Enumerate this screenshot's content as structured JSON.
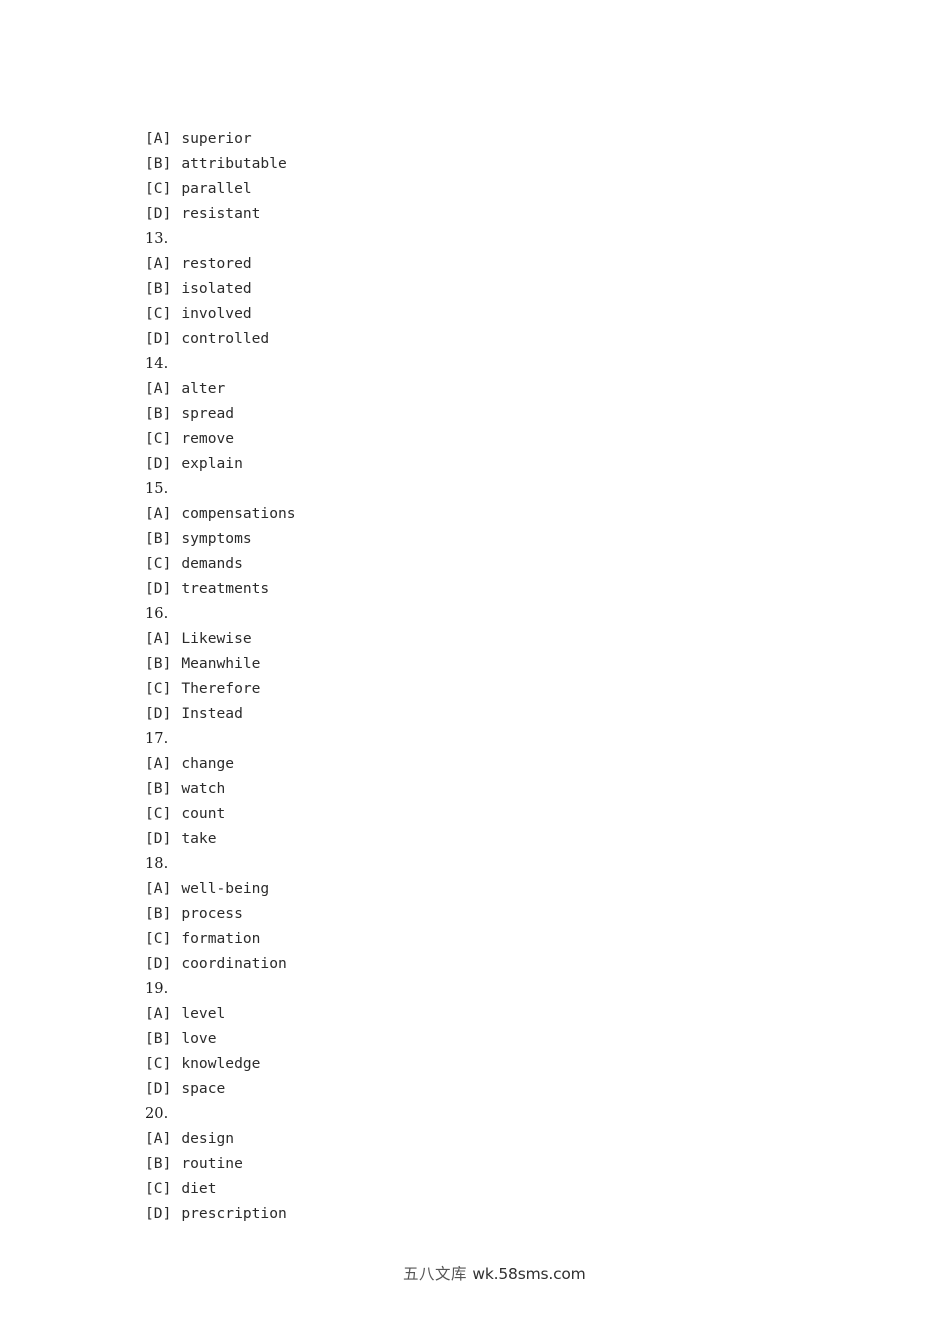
{
  "document": {
    "background_color": "#ffffff",
    "text_color": "#2b2b2b",
    "lines": [
      {
        "kind": "option",
        "tag": "[A]",
        "text": "superior"
      },
      {
        "kind": "option",
        "tag": "[B]",
        "text": "attributable"
      },
      {
        "kind": "option",
        "tag": "[C]",
        "text": "parallel"
      },
      {
        "kind": "option",
        "tag": "[D]",
        "text": "resistant"
      },
      {
        "kind": "question",
        "tag": "",
        "text": "13."
      },
      {
        "kind": "option",
        "tag": "[A]",
        "text": "restored"
      },
      {
        "kind": "option",
        "tag": "[B]",
        "text": "isolated"
      },
      {
        "kind": "option",
        "tag": "[C]",
        "text": "involved"
      },
      {
        "kind": "option",
        "tag": "[D]",
        "text": "controlled"
      },
      {
        "kind": "question",
        "tag": "",
        "text": "14."
      },
      {
        "kind": "option",
        "tag": "[A]",
        "text": "alter"
      },
      {
        "kind": "option",
        "tag": "[B]",
        "text": "spread"
      },
      {
        "kind": "option",
        "tag": "[C]",
        "text": "remove"
      },
      {
        "kind": "option",
        "tag": "[D]",
        "text": "explain"
      },
      {
        "kind": "question",
        "tag": "",
        "text": "15."
      },
      {
        "kind": "option",
        "tag": "[A]",
        "text": "compensations"
      },
      {
        "kind": "option",
        "tag": "[B]",
        "text": "symptoms"
      },
      {
        "kind": "option",
        "tag": "[C]",
        "text": "demands"
      },
      {
        "kind": "option",
        "tag": "[D]",
        "text": "treatments"
      },
      {
        "kind": "question",
        "tag": "",
        "text": "16."
      },
      {
        "kind": "option",
        "tag": "[A]",
        "text": "Likewise"
      },
      {
        "kind": "option",
        "tag": "[B]",
        "text": "Meanwhile"
      },
      {
        "kind": "option",
        "tag": "[C]",
        "text": "Therefore"
      },
      {
        "kind": "option",
        "tag": "[D]",
        "text": "Instead"
      },
      {
        "kind": "question",
        "tag": "",
        "text": "17."
      },
      {
        "kind": "option",
        "tag": "[A]",
        "text": "change"
      },
      {
        "kind": "option",
        "tag": "[B]",
        "text": "watch"
      },
      {
        "kind": "option",
        "tag": "[C]",
        "text": "count"
      },
      {
        "kind": "option",
        "tag": "[D]",
        "text": "take"
      },
      {
        "kind": "question",
        "tag": "",
        "text": "18."
      },
      {
        "kind": "option",
        "tag": "[A]",
        "text": "well-being"
      },
      {
        "kind": "option",
        "tag": "[B]",
        "text": "process"
      },
      {
        "kind": "option",
        "tag": "[C]",
        "text": "formation"
      },
      {
        "kind": "option",
        "tag": "[D]",
        "text": "coordination"
      },
      {
        "kind": "question",
        "tag": "",
        "text": "19."
      },
      {
        "kind": "option",
        "tag": "[A]",
        "text": "level"
      },
      {
        "kind": "option",
        "tag": "[B]",
        "text": "love"
      },
      {
        "kind": "option",
        "tag": "[C]",
        "text": "knowledge"
      },
      {
        "kind": "option",
        "tag": "[D]",
        "text": "space"
      },
      {
        "kind": "question",
        "tag": "",
        "text": "20."
      },
      {
        "kind": "option",
        "tag": "[A]",
        "text": "design"
      },
      {
        "kind": "option",
        "tag": "[B]",
        "text": "routine"
      },
      {
        "kind": "option",
        "tag": "[C]",
        "text": "diet"
      },
      {
        "kind": "option",
        "tag": "[D]",
        "text": "prescription"
      }
    ]
  },
  "watermark": {
    "cjk_text": "五八文库",
    "url_text": "wk.58sms.com",
    "cjk_color": "#555555",
    "url_color": "#303030"
  }
}
